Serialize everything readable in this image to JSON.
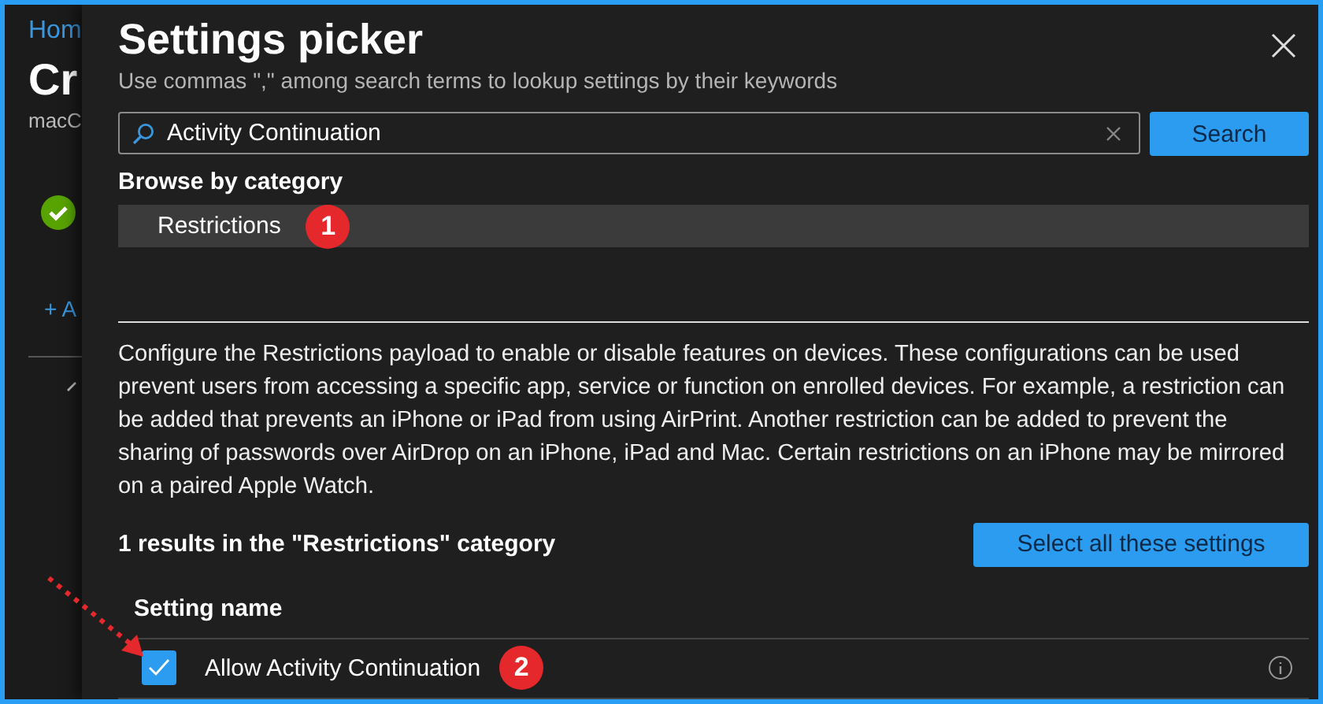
{
  "background": {
    "breadcrumb": "Hom",
    "title": "Cr",
    "subtitle": "macC",
    "add_link": "+ A"
  },
  "dialog": {
    "title": "Settings picker",
    "hint": "Use commas \",\" among search terms to lookup settings by their keywords",
    "search": {
      "value": "Activity Continuation"
    },
    "search_button": "Search",
    "browse_heading": "Browse by category",
    "categories": [
      {
        "label": "Restrictions",
        "selected": true,
        "badge": "1"
      }
    ],
    "description": "Configure the Restrictions payload to enable or disable features on devices. These configurations can be used prevent users from accessing a specific app, service or function on enrolled devices. For example, a restriction can be added that prevents an iPhone or iPad from using AirPrint. Another restriction can be added to prevent the sharing of passwords over AirDrop on an iPhone, iPad and Mac. Certain restrictions on an iPhone may be mirrored on a paired Apple Watch.",
    "results_summary": "1 results in the \"Restrictions\" category",
    "select_all_button": "Select all these settings",
    "column_header": "Setting name",
    "settings": [
      {
        "name": "Allow Activity Continuation",
        "checked": true,
        "badge": "2"
      }
    ]
  }
}
